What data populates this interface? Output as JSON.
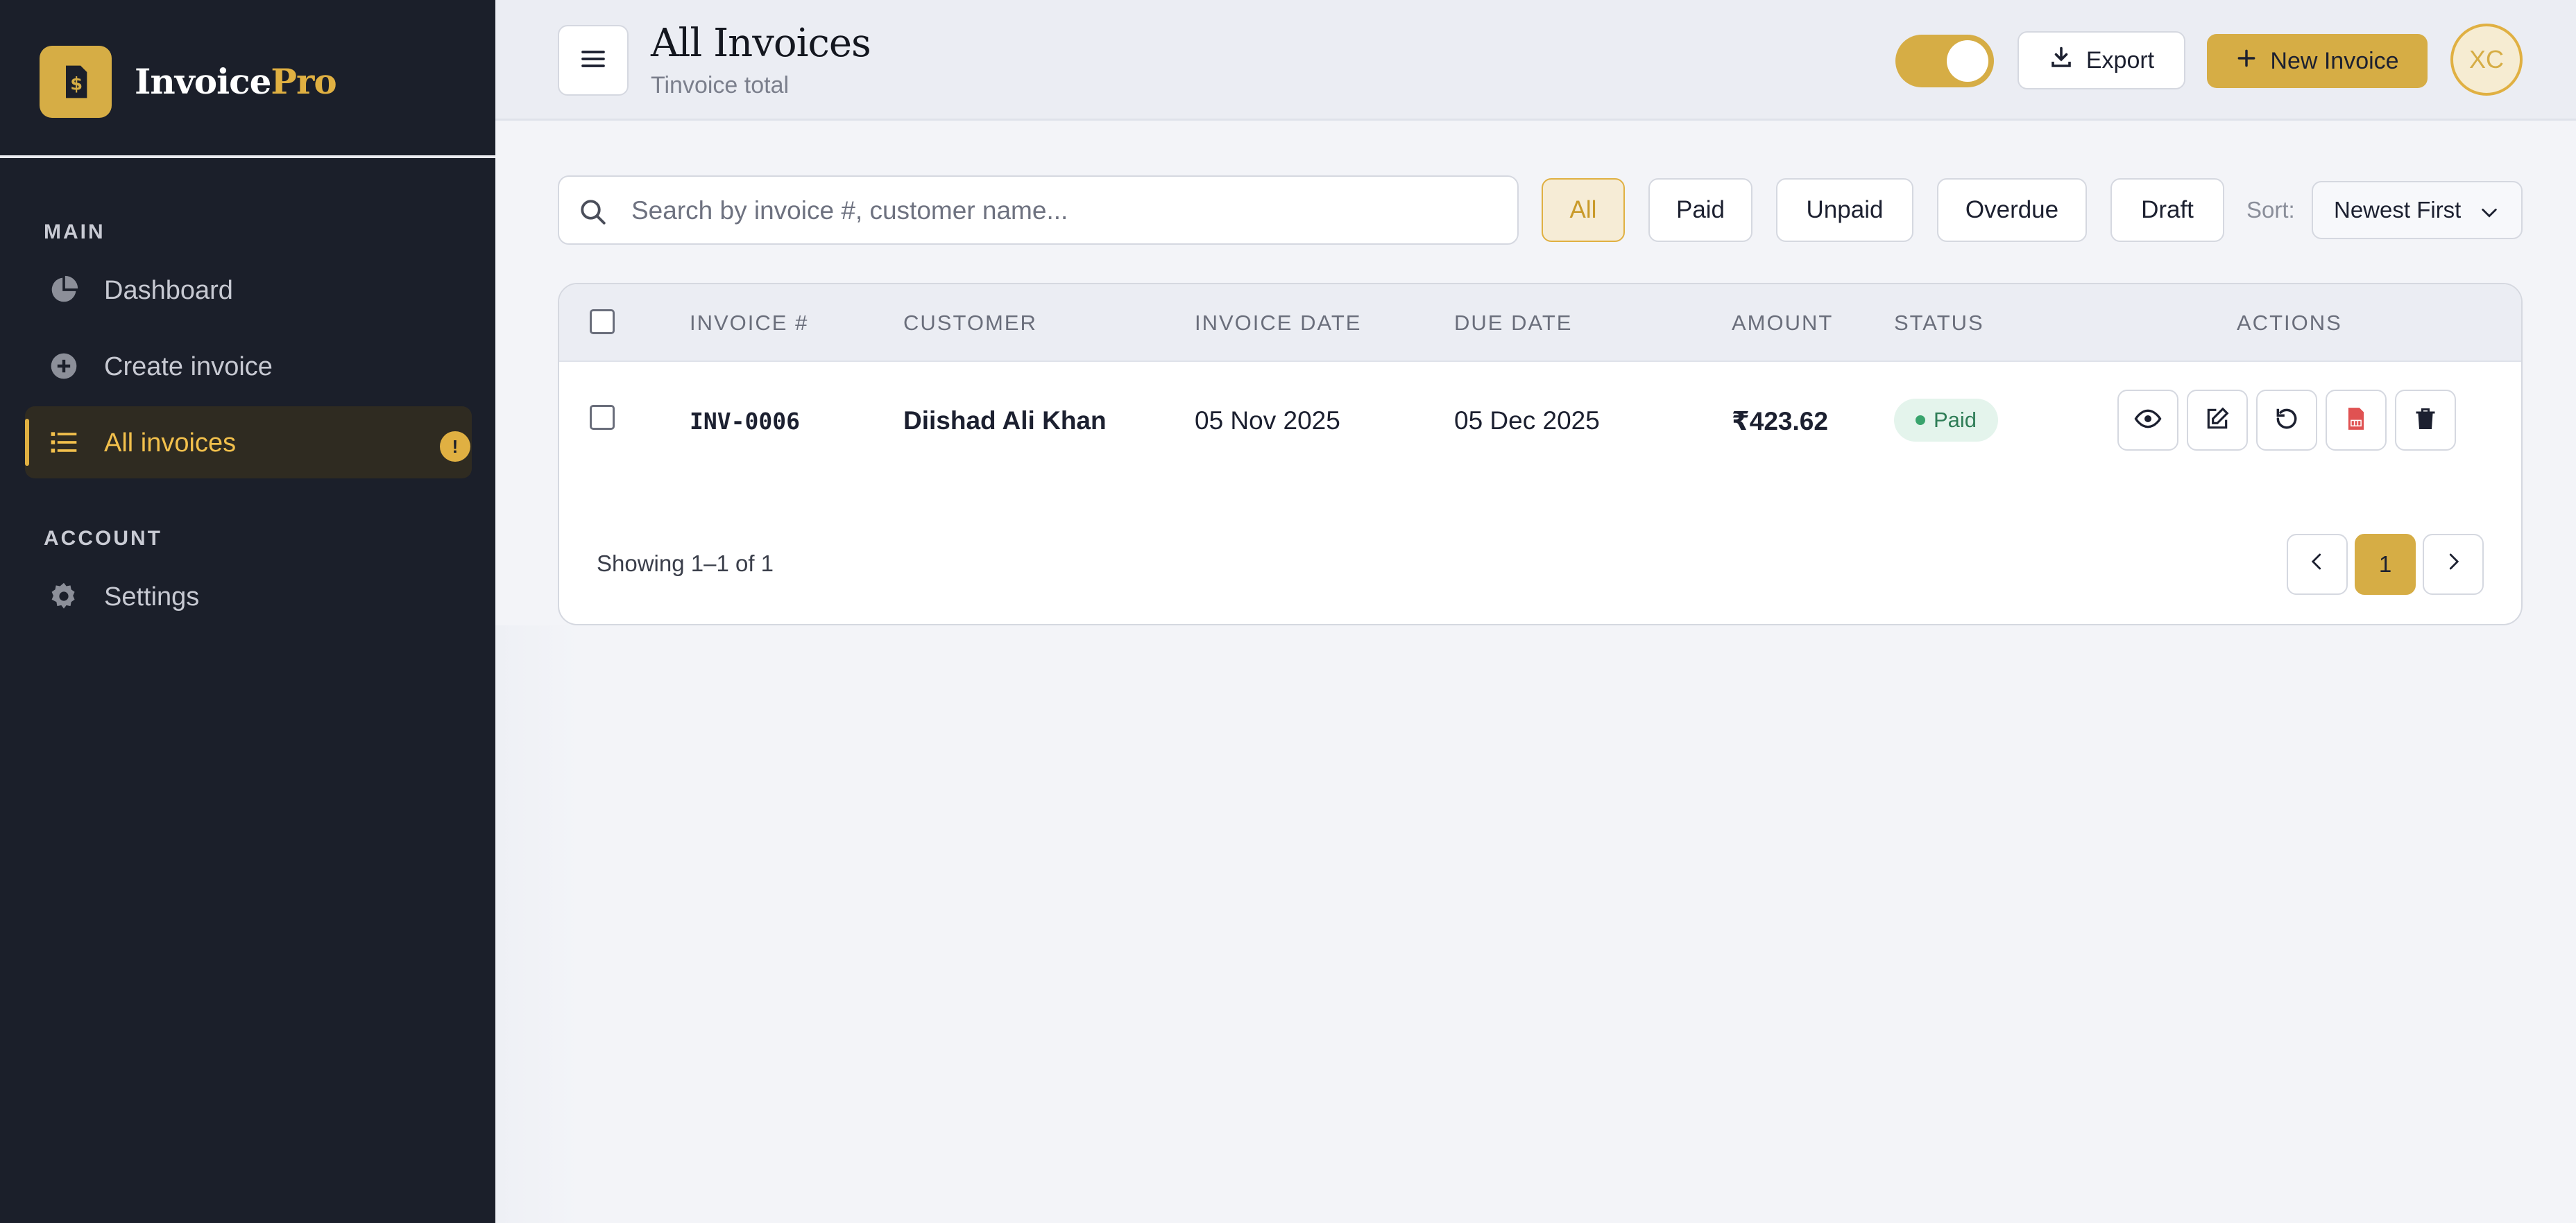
{
  "app": {
    "brand_main": "Invoice",
    "brand_accent": "Pro",
    "colors": {
      "accent": "#d6ad45",
      "sidebar": "#1b1f2a",
      "paid": "#39a46d",
      "pdf": "#e05252"
    }
  },
  "sidebar": {
    "main_label": "MAIN",
    "account_label": "ACCOUNT",
    "items": [
      {
        "label": "Dashboard",
        "icon": "pie-chart-icon"
      },
      {
        "label": "Create invoice",
        "icon": "plus-circle-icon"
      },
      {
        "label": "All invoices",
        "icon": "list-icon",
        "badge": "!"
      },
      {
        "label": "Settings",
        "icon": "gear-icon"
      }
    ]
  },
  "header": {
    "title": "All Invoices",
    "subtitle": "Tinvoice total",
    "export_label": "Export",
    "new_invoice_label": "New Invoice",
    "avatar_initials": "XC"
  },
  "toolbar": {
    "search_placeholder": "Search by invoice #, customer name...",
    "filters": [
      "All",
      "Paid",
      "Unpaid",
      "Overdue",
      "Draft"
    ],
    "active_filter": "All",
    "sort_label": "Sort:",
    "sort_value": "Newest First"
  },
  "table": {
    "columns": [
      "INVOICE #",
      "CUSTOMER",
      "INVOICE DATE",
      "DUE DATE",
      "AMOUNT",
      "STATUS",
      "ACTIONS"
    ],
    "rows": [
      {
        "invoice_no": "INV-0006",
        "customer": "Diishad Ali Khan",
        "invoice_date": "05 Nov 2025",
        "due_date": "05 Dec 2025",
        "amount": "₹423.62",
        "status": "Paid"
      }
    ],
    "row_actions": [
      "view-icon",
      "edit-icon",
      "undo-icon",
      "pdf-icon",
      "trash-icon"
    ]
  },
  "pagination": {
    "showing_text": "Showing 1–1 of 1",
    "current_page": "1"
  }
}
